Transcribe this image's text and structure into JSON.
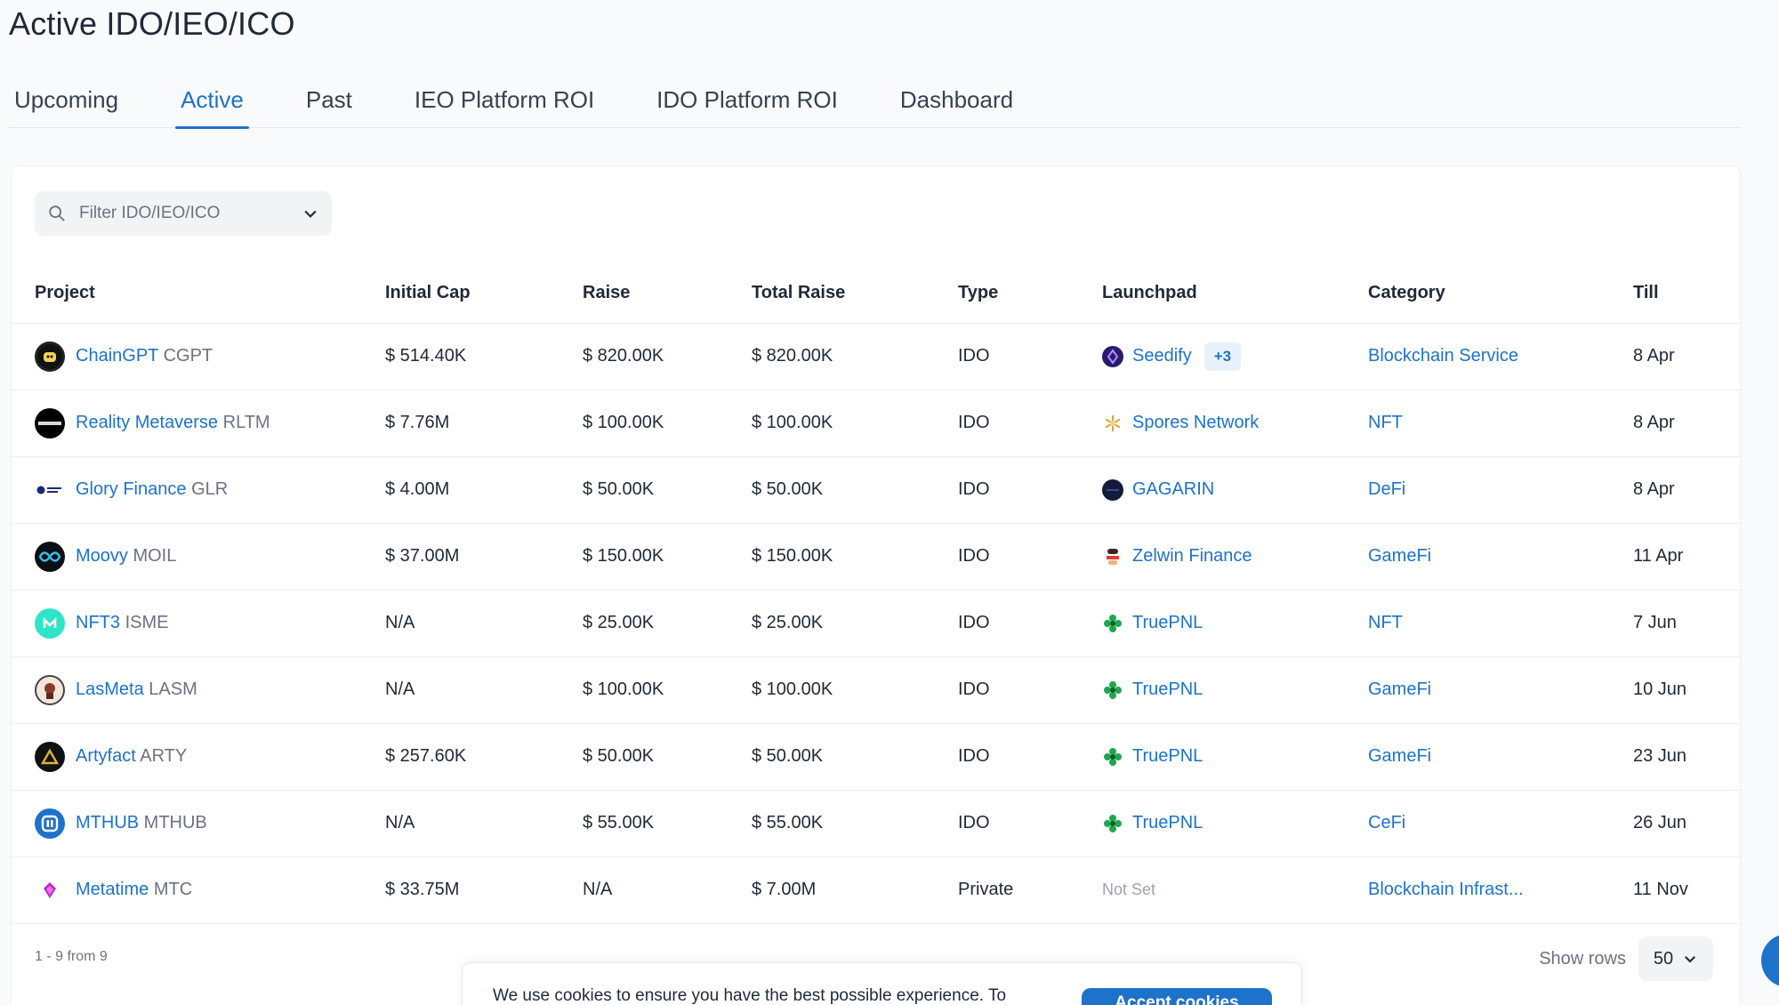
{
  "page": {
    "title": "Active IDO/IEO/ICO"
  },
  "tabs": [
    {
      "label": "Upcoming",
      "active": false
    },
    {
      "label": "Active",
      "active": true
    },
    {
      "label": "Past",
      "active": false
    },
    {
      "label": "IEO Platform ROI",
      "active": false
    },
    {
      "label": "IDO Platform ROI",
      "active": false
    },
    {
      "label": "Dashboard",
      "active": false
    }
  ],
  "filter": {
    "placeholder": "Filter IDO/IEO/ICO"
  },
  "table": {
    "headers": {
      "project": "Project",
      "initial_cap": "Initial Cap",
      "raise": "Raise",
      "total_raise": "Total Raise",
      "type": "Type",
      "launchpad": "Launchpad",
      "category": "Category",
      "till": "Till"
    },
    "rows": [
      {
        "name": "ChainGPT",
        "symbol": "CGPT",
        "logo_icon": "chaingpt-logo",
        "initial_cap": "$ 514.40K",
        "raise": "$ 820.00K",
        "total_raise": "$ 820.00K",
        "type": "IDO",
        "launchpad": "Seedify",
        "launchpad_icon": "seedify-logo",
        "launchpad_more": "+3",
        "category": "Blockchain Service",
        "till": "8 Apr"
      },
      {
        "name": "Reality Metaverse",
        "symbol": "RLTM",
        "logo_icon": "reality-metaverse-logo",
        "initial_cap": "$ 7.76M",
        "raise": "$ 100.00K",
        "total_raise": "$ 100.00K",
        "type": "IDO",
        "launchpad": "Spores Network",
        "launchpad_icon": "spores-logo",
        "launchpad_more": "",
        "category": "NFT",
        "till": "8 Apr"
      },
      {
        "name": "Glory Finance",
        "symbol": "GLR",
        "logo_icon": "glory-finance-logo",
        "initial_cap": "$ 4.00M",
        "raise": "$ 50.00K",
        "total_raise": "$ 50.00K",
        "type": "IDO",
        "launchpad": "GAGARIN",
        "launchpad_icon": "gagarin-logo",
        "launchpad_more": "",
        "category": "DeFi",
        "till": "8 Apr"
      },
      {
        "name": "Moovy",
        "symbol": "MOIL",
        "logo_icon": "moovy-logo",
        "initial_cap": "$ 37.00M",
        "raise": "$ 150.00K",
        "total_raise": "$ 150.00K",
        "type": "IDO",
        "launchpad": "Zelwin Finance",
        "launchpad_icon": "zelwin-logo",
        "launchpad_more": "",
        "category": "GameFi",
        "till": "11 Apr"
      },
      {
        "name": "NFT3",
        "symbol": "ISME",
        "logo_icon": "nft3-logo",
        "initial_cap": "N/A",
        "raise": "$ 25.00K",
        "total_raise": "$ 25.00K",
        "type": "IDO",
        "launchpad": "TruePNL",
        "launchpad_icon": "truepnl-logo",
        "launchpad_more": "",
        "category": "NFT",
        "till": "7 Jun"
      },
      {
        "name": "LasMeta",
        "symbol": "LASM",
        "logo_icon": "lasmeta-logo",
        "initial_cap": "N/A",
        "raise": "$ 100.00K",
        "total_raise": "$ 100.00K",
        "type": "IDO",
        "launchpad": "TruePNL",
        "launchpad_icon": "truepnl-logo",
        "launchpad_more": "",
        "category": "GameFi",
        "till": "10 Jun"
      },
      {
        "name": "Artyfact",
        "symbol": "ARTY",
        "logo_icon": "artyfact-logo",
        "initial_cap": "$ 257.60K",
        "raise": "$ 50.00K",
        "total_raise": "$ 50.00K",
        "type": "IDO",
        "launchpad": "TruePNL",
        "launchpad_icon": "truepnl-logo",
        "launchpad_more": "",
        "category": "GameFi",
        "till": "23 Jun"
      },
      {
        "name": "MTHUB",
        "symbol": "MTHUB",
        "logo_icon": "mthub-logo",
        "initial_cap": "N/A",
        "raise": "$ 55.00K",
        "total_raise": "$ 55.00K",
        "type": "IDO",
        "launchpad": "TruePNL",
        "launchpad_icon": "truepnl-logo",
        "launchpad_more": "",
        "category": "CeFi",
        "till": "26 Jun"
      },
      {
        "name": "Metatime",
        "symbol": "MTC",
        "logo_icon": "metatime-logo",
        "initial_cap": "$ 33.75M",
        "raise": "N/A",
        "total_raise": "$ 7.00M",
        "type": "Private",
        "launchpad": "Not Set",
        "launchpad_icon": "",
        "launchpad_more": "",
        "category": "Blockchain Infrast...",
        "till": "11 Nov"
      }
    ]
  },
  "pagination": {
    "info": "1 - 9 from 9",
    "show_rows_label": "Show rows",
    "rows_value": "50"
  },
  "cookie": {
    "text": "We use cookies to ensure you have the best possible experience. To",
    "button": "Accept cookies"
  },
  "colors": {
    "accent": "#1d72c9",
    "text": "#1f2937",
    "muted": "#6b7280",
    "bg": "#f9fafb"
  }
}
